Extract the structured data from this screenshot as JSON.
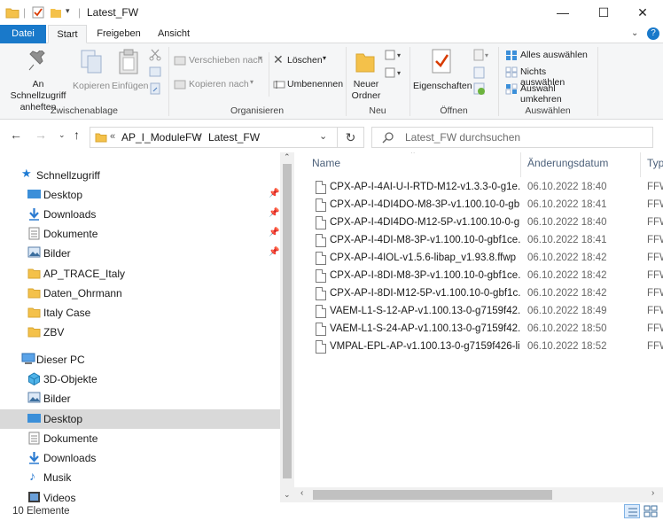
{
  "window": {
    "title": "Latest_FW",
    "minimize_glyph": "—",
    "maximize_glyph": "☐",
    "close_glyph": "✕"
  },
  "ribbon_tabs": [
    {
      "label": "Datei"
    },
    {
      "label": "Start"
    },
    {
      "label": "Freigeben"
    },
    {
      "label": "Ansicht"
    }
  ],
  "ribbon": {
    "clipboard": {
      "pin_label": "An Schnellzugriff anheften",
      "copy_label": "Kopieren",
      "paste_label": "Einfügen",
      "group_label": "Zwischenablage"
    },
    "organize": {
      "move_to_label": "Verschieben nach",
      "copy_to_label": "Kopieren nach",
      "delete_label": "Löschen",
      "rename_label": "Umbenennen",
      "group_label": "Organisieren"
    },
    "new": {
      "new_folder_label": "Neuer Ordner",
      "group_label": "Neu"
    },
    "open": {
      "properties_label": "Eigenschaften",
      "group_label": "Öffnen"
    },
    "select": {
      "select_all_label": "Alles auswählen",
      "select_none_label": "Nichts auswählen",
      "invert_label": "Auswahl umkehren",
      "group_label": "Auswählen"
    }
  },
  "address": {
    "crumb_sep": "«",
    "crumb_1": "AP_I_ModuleFW",
    "crumb_arrow": "›",
    "crumb_2": "Latest_FW",
    "search_placeholder": "Latest_FW durchsuchen"
  },
  "nav": {
    "quick_access": "Schnellzugriff",
    "quick_items": [
      {
        "label": "Desktop",
        "pinned": true
      },
      {
        "label": "Downloads",
        "pinned": true
      },
      {
        "label": "Dokumente",
        "pinned": true
      },
      {
        "label": "Bilder",
        "pinned": true
      },
      {
        "label": "AP_TRACE_Italy",
        "pinned": false
      },
      {
        "label": "Daten_Ohrmann",
        "pinned": false
      },
      {
        "label": "Italy Case",
        "pinned": false
      },
      {
        "label": "ZBV",
        "pinned": false
      }
    ],
    "this_pc": "Dieser PC",
    "pc_items": [
      {
        "label": "3D-Objekte"
      },
      {
        "label": "Bilder"
      },
      {
        "label": "Desktop"
      },
      {
        "label": "Dokumente"
      },
      {
        "label": "Downloads"
      },
      {
        "label": "Musik"
      },
      {
        "label": "Videos"
      }
    ]
  },
  "columns": {
    "name": "Name",
    "date": "Änderungsdatum",
    "type": "Typ"
  },
  "files": [
    {
      "name": "CPX-AP-I-4AI-U-I-RTD-M12-v1.3.3-0-g1e...",
      "date": "06.10.2022 18:40",
      "type": "FFW"
    },
    {
      "name": "CPX-AP-I-4DI4DO-M8-3P-v1.100.10-0-gb...",
      "date": "06.10.2022 18:41",
      "type": "FFW"
    },
    {
      "name": "CPX-AP-I-4DI4DO-M12-5P-v1.100.10-0-g...",
      "date": "06.10.2022 18:40",
      "type": "FFW"
    },
    {
      "name": "CPX-AP-I-4DI-M8-3P-v1.100.10-0-gbf1ce...",
      "date": "06.10.2022 18:41",
      "type": "FFW"
    },
    {
      "name": "CPX-AP-I-4IOL-v1.5.6-libap_v1.93.8.ffwp",
      "date": "06.10.2022 18:42",
      "type": "FFW"
    },
    {
      "name": "CPX-AP-I-8DI-M8-3P-v1.100.10-0-gbf1ce...",
      "date": "06.10.2022 18:42",
      "type": "FFW"
    },
    {
      "name": "CPX-AP-I-8DI-M12-5P-v1.100.10-0-gbf1c...",
      "date": "06.10.2022 18:42",
      "type": "FFW"
    },
    {
      "name": "VAEM-L1-S-12-AP-v1.100.13-0-g7159f42...",
      "date": "06.10.2022 18:49",
      "type": "FFW"
    },
    {
      "name": "VAEM-L1-S-24-AP-v1.100.13-0-g7159f42...",
      "date": "06.10.2022 18:50",
      "type": "FFW"
    },
    {
      "name": "VMPAL-EPL-AP-v1.100.13-0-g7159f426-li...",
      "date": "06.10.2022 18:52",
      "type": "FFW"
    }
  ],
  "status": {
    "item_count": "10 Elemente"
  },
  "colors": {
    "accent": "#1979ca",
    "folder": "#f4c14a",
    "selected": "#d9d9d9"
  }
}
